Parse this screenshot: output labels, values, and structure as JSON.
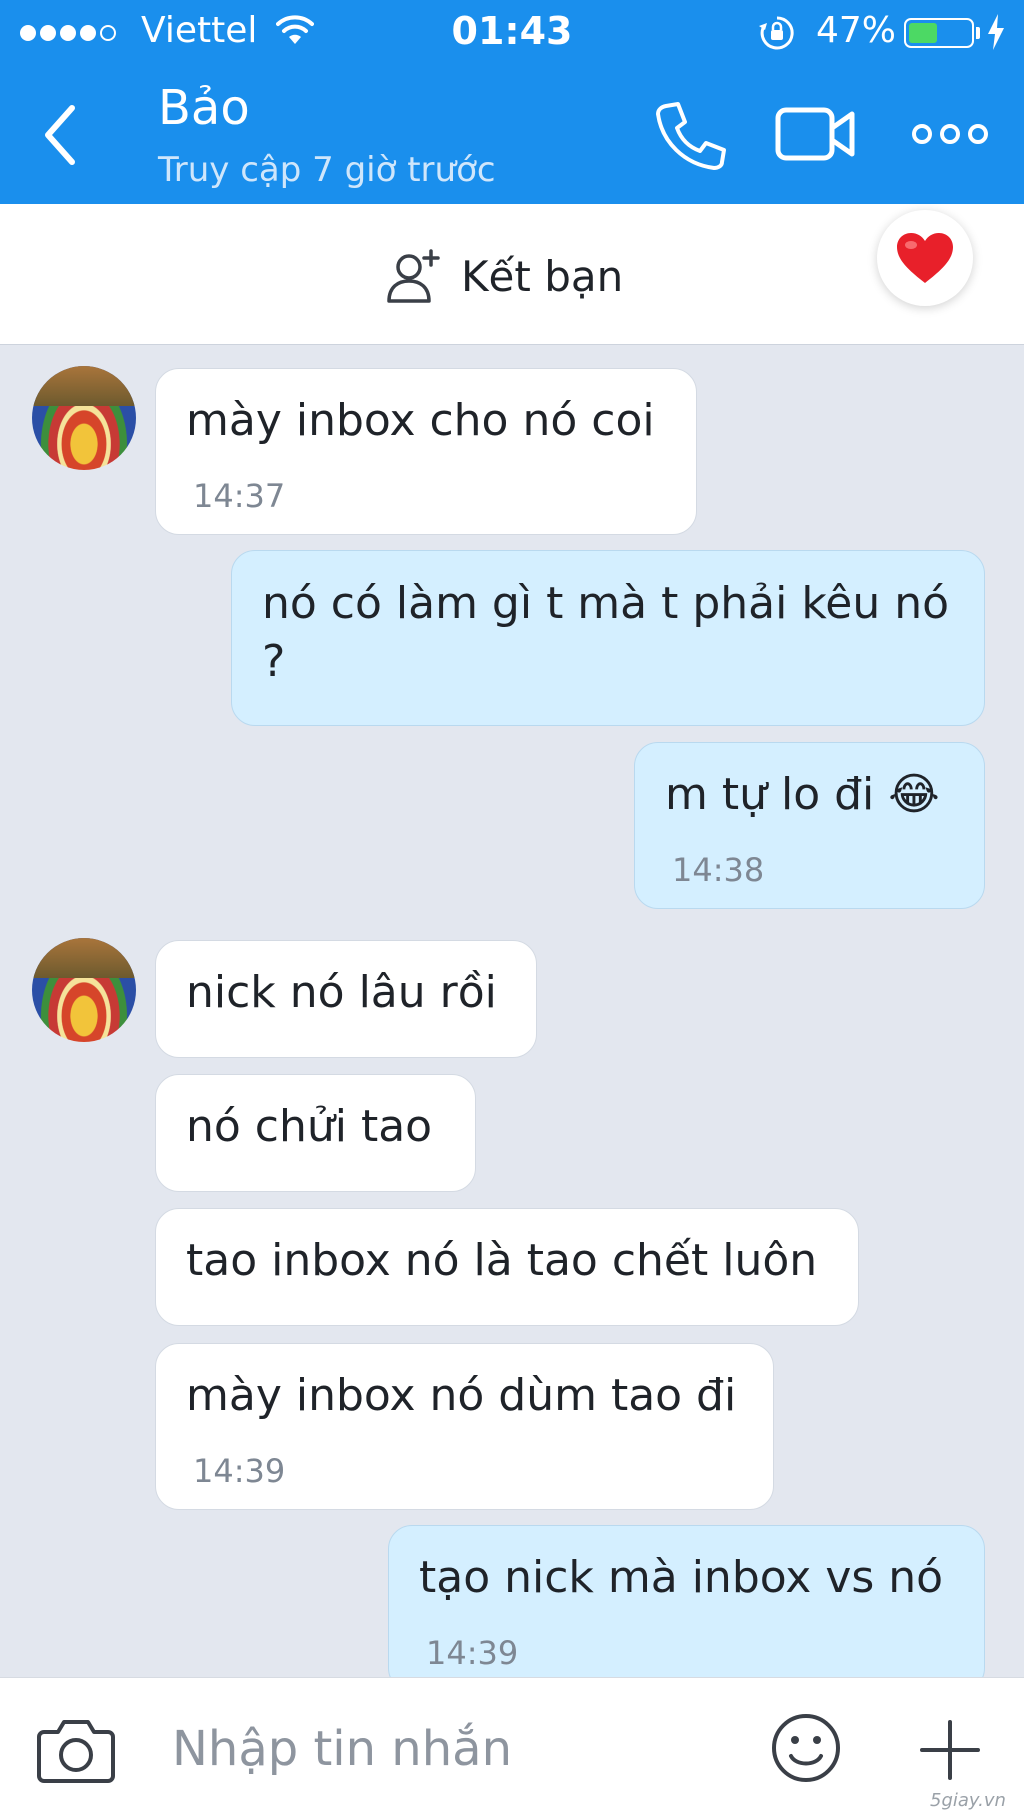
{
  "status_bar": {
    "carrier": "Viettel",
    "time": "01:43",
    "battery": "47%",
    "battery_level": 0.47,
    "signal_icon": "signal-dots-icon",
    "wifi_icon": "wifi-icon",
    "lock_icon": "rotation-lock-icon",
    "charging_icon": "charging-bolt-icon"
  },
  "header": {
    "contact_name": "Bảo",
    "contact_status": "Truy cập 7 giờ trước",
    "background_color": "#1a8fed",
    "back_icon": "chevron-left-icon",
    "call_icon": "phone-icon",
    "video_icon": "video-camera-icon",
    "more_icon": "more-dots-icon"
  },
  "friend_bar": {
    "add_friend_label": "Kết bạn",
    "add_friend_icon": "add-user-icon",
    "heart_icon": "heart-icon"
  },
  "messages": [
    {
      "sender": "other",
      "text": "mày inbox cho nó coi",
      "time": "14:37"
    },
    {
      "sender": "me",
      "text": "nó có làm gì t mà t phải kêu nó ?",
      "time": ""
    },
    {
      "sender": "me",
      "text": "m tự lo đi 😂",
      "time": "14:38"
    },
    {
      "sender": "other",
      "text": "nick nó lâu rồi",
      "time": ""
    },
    {
      "sender": "other",
      "text": "nó chửi tao",
      "time": ""
    },
    {
      "sender": "other",
      "text": "tao inbox nó là tao chết luôn",
      "time": ""
    },
    {
      "sender": "other",
      "text": "mày inbox nó dùm tao đi",
      "time": "14:39"
    },
    {
      "sender": "me",
      "text": "tạo nick mà inbox vs nó",
      "time": "14:39"
    }
  ],
  "input_bar": {
    "placeholder": "Nhập tin nhắn",
    "value": "",
    "camera_icon": "camera-icon",
    "emoji_icon": "smiley-icon",
    "plus_icon": "plus-icon"
  },
  "watermark": "5giay.vn",
  "colors": {
    "header_blue": "#1a8fed",
    "chat_background": "#e3e7ef",
    "my_bubble": "#d4efff",
    "their_bubble": "#ffffff",
    "heart_red": "#e8202a"
  }
}
